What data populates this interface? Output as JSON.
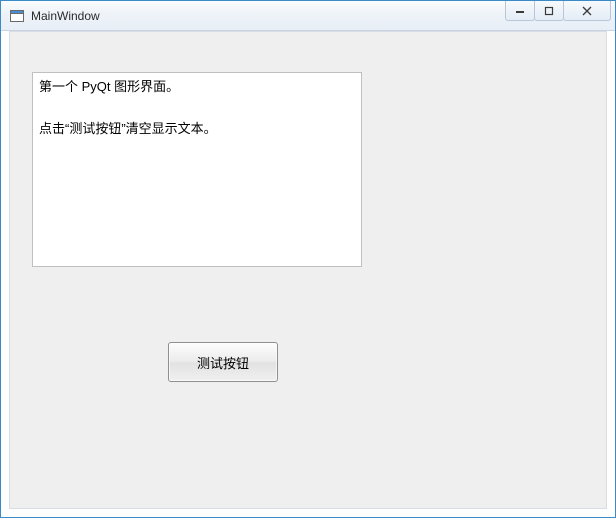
{
  "window": {
    "title": "MainWindow"
  },
  "content": {
    "text_area": "第一个 PyQt 图形界面。\n\n点击“测试按钮”清空显示文本。",
    "test_button_label": "测试按钮"
  },
  "icons": {
    "app": "app-icon",
    "minimize": "minimize-icon",
    "maximize": "maximize-icon",
    "close": "close-icon"
  }
}
